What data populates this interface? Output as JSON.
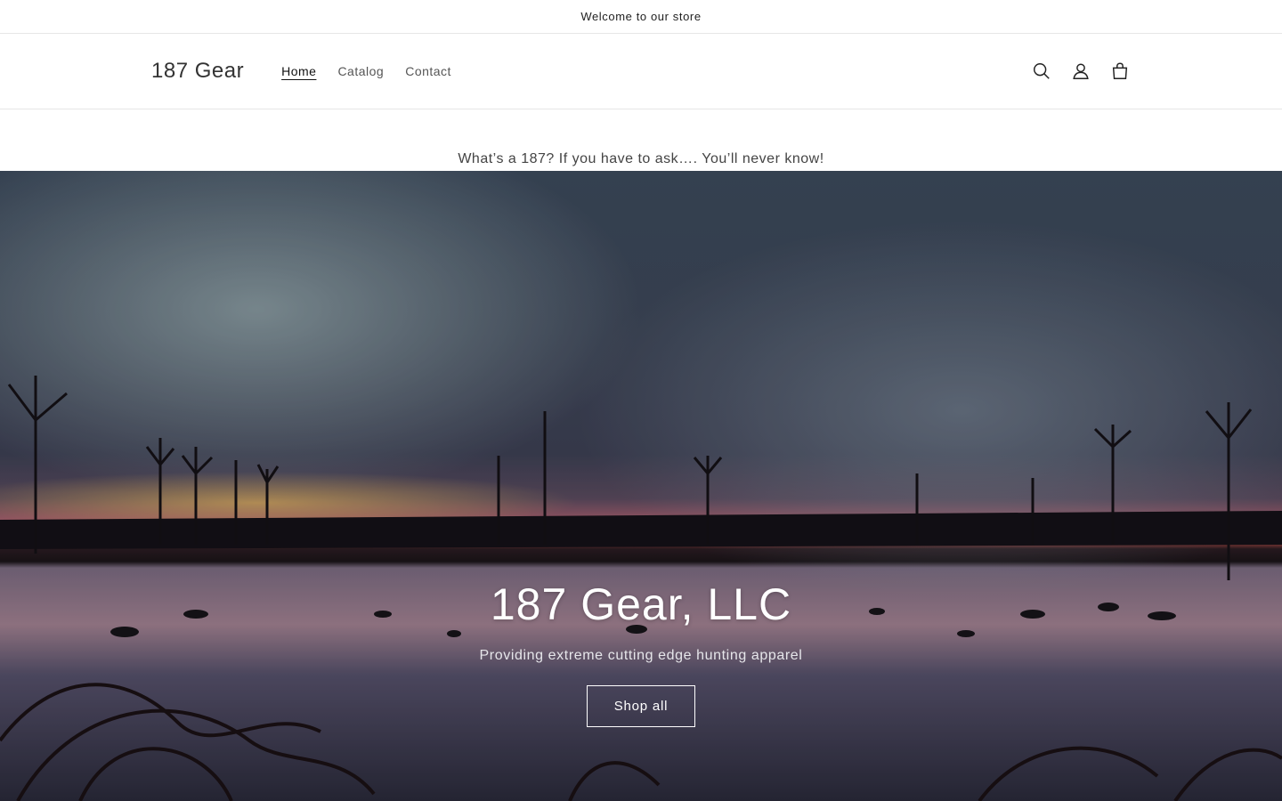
{
  "announcement": {
    "text": "Welcome to our store"
  },
  "header": {
    "logo": "187 Gear",
    "nav": [
      {
        "label": "Home",
        "active": true
      },
      {
        "label": "Catalog",
        "active": false
      },
      {
        "label": "Contact",
        "active": false
      }
    ],
    "icons": [
      "search-icon",
      "account-icon",
      "cart-icon"
    ]
  },
  "tagline": "What’s a 187? If you have to ask…. You’ll never know!",
  "hero": {
    "title": "187 Gear, LLC",
    "subtitle": "Providing extreme cutting edge hunting apparel",
    "button_label": "Shop all"
  }
}
